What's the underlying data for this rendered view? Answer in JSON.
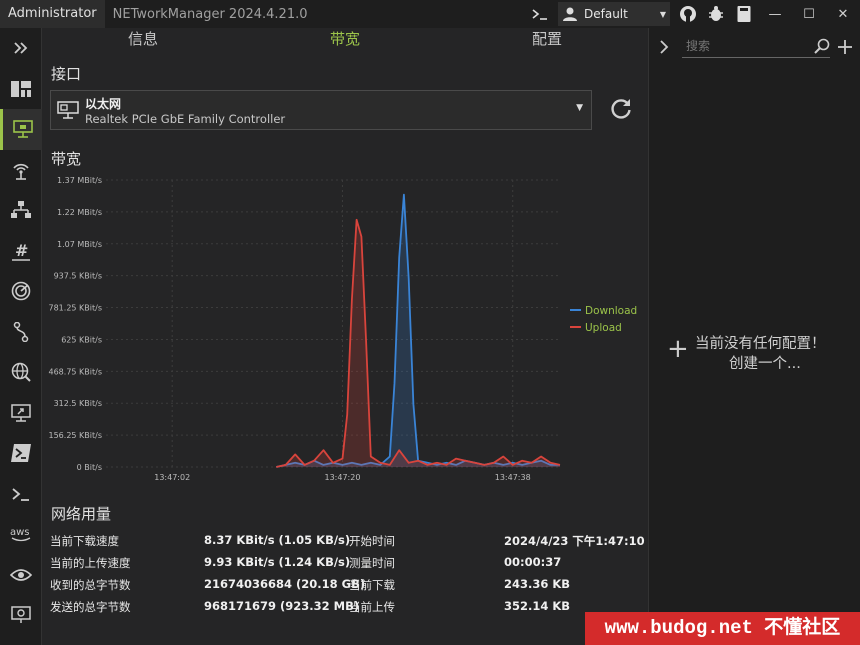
{
  "titlebar": {
    "admin_label": "Administrator",
    "app_title": "NETworkManager 2024.4.21.0",
    "profile": "Default"
  },
  "tabs": [
    "信息",
    "带宽",
    "配置"
  ],
  "interface": {
    "section_title": "接口",
    "name": "以太网",
    "description": "Realtek PCIe GbE Family Controller"
  },
  "bandwidth": {
    "section_title": "带宽"
  },
  "chart_data": {
    "type": "line",
    "ylim": [
      0,
      1.37
    ],
    "y_unit": "MBit/s",
    "yticks": [
      "1.37 MBit/s",
      "1.22 MBit/s",
      "1.07 MBit/s",
      "937.5 KBit/s",
      "781.25 KBit/s",
      "625 KBit/s",
      "468.75 KBit/s",
      "312.5 KBit/s",
      "156.25 KBit/s",
      "0 Bit/s"
    ],
    "xticks": [
      "13:47:02",
      "13:47:20",
      "13:47:38"
    ],
    "xlim_seconds": [
      0,
      48
    ],
    "xtick_seconds": [
      7,
      25,
      43
    ],
    "legend_position": "right",
    "series": [
      {
        "name": "Download",
        "color": "#3a84d6",
        "x": [
          18,
          19,
          20,
          21,
          22,
          23,
          24,
          25,
          26,
          27,
          28,
          29,
          30,
          30.5,
          31,
          31.5,
          32,
          32.5,
          33,
          34,
          35,
          36,
          37,
          38,
          39,
          40,
          41,
          42,
          43,
          44,
          45,
          46,
          47,
          48
        ],
        "values": [
          0,
          0.01,
          0.02,
          0.01,
          0.03,
          0.01,
          0.02,
          0.01,
          0.02,
          0.01,
          0.02,
          0.01,
          0.05,
          0.4,
          1.0,
          1.3,
          0.9,
          0.3,
          0.03,
          0.02,
          0.01,
          0.02,
          0.01,
          0.03,
          0.02,
          0.01,
          0.02,
          0.01,
          0.02,
          0.01,
          0.02,
          0.03,
          0.01,
          0.01
        ]
      },
      {
        "name": "Upload",
        "color": "#d9443c",
        "x": [
          18,
          19,
          20,
          21,
          22,
          23,
          24,
          25,
          25.5,
          26,
          26.5,
          27,
          27.5,
          28,
          29,
          30,
          31,
          32,
          33,
          34,
          35,
          36,
          37,
          38,
          39,
          40,
          41,
          42,
          43,
          44,
          45,
          46,
          47,
          48
        ],
        "values": [
          0,
          0.01,
          0.06,
          0.01,
          0.03,
          0.08,
          0.02,
          0.04,
          0.25,
          0.8,
          1.18,
          1.1,
          0.6,
          0.05,
          0.02,
          0.01,
          0.08,
          0.02,
          0.03,
          0.01,
          0.02,
          0.01,
          0.04,
          0.03,
          0.02,
          0.01,
          0.02,
          0.05,
          0.01,
          0.03,
          0.02,
          0.05,
          0.02,
          0.01
        ]
      }
    ]
  },
  "usage": {
    "section_title": "网络用量",
    "rows": [
      {
        "label": "当前下载速度",
        "value": "8.37 KBit/s (1.05 KB/s)",
        "label2": "开始时间",
        "value2": "2024/4/23 下午1:47:10"
      },
      {
        "label": "当前的上传速度",
        "value": "9.93 KBit/s (1.24 KB/s)",
        "label2": "测量时间",
        "value2": "00:00:37"
      },
      {
        "label": "收到的总字节数",
        "value": "21674036684 (20.18 GB)",
        "label2": "当前下载",
        "value2": "243.36 KB"
      },
      {
        "label": "发送的总字节数",
        "value": "968171679 (923.32 MB)",
        "label2": "当前上传",
        "value2": "352.14 KB"
      }
    ]
  },
  "right_panel": {
    "search_placeholder": "搜索",
    "empty_line1": "当前没有任何配置！",
    "empty_line2": "创建一个..."
  },
  "sidebar_icons": [
    "dashboard-icon",
    "network-interface-icon",
    "wifi-icon",
    "ip-scanner-icon",
    "subnet-icon",
    "port-scanner-icon",
    "traceroute-icon",
    "dns-icon",
    "remote-desktop-icon",
    "powershell-icon",
    "terminal-icon",
    "aws-icon",
    "eye-icon",
    "screen-icon",
    "settings-icon"
  ],
  "sidebar_labels": {
    "aws": "aws"
  },
  "accent_color": "#9bc34a",
  "watermark": "www.budog.net 不懂社区"
}
